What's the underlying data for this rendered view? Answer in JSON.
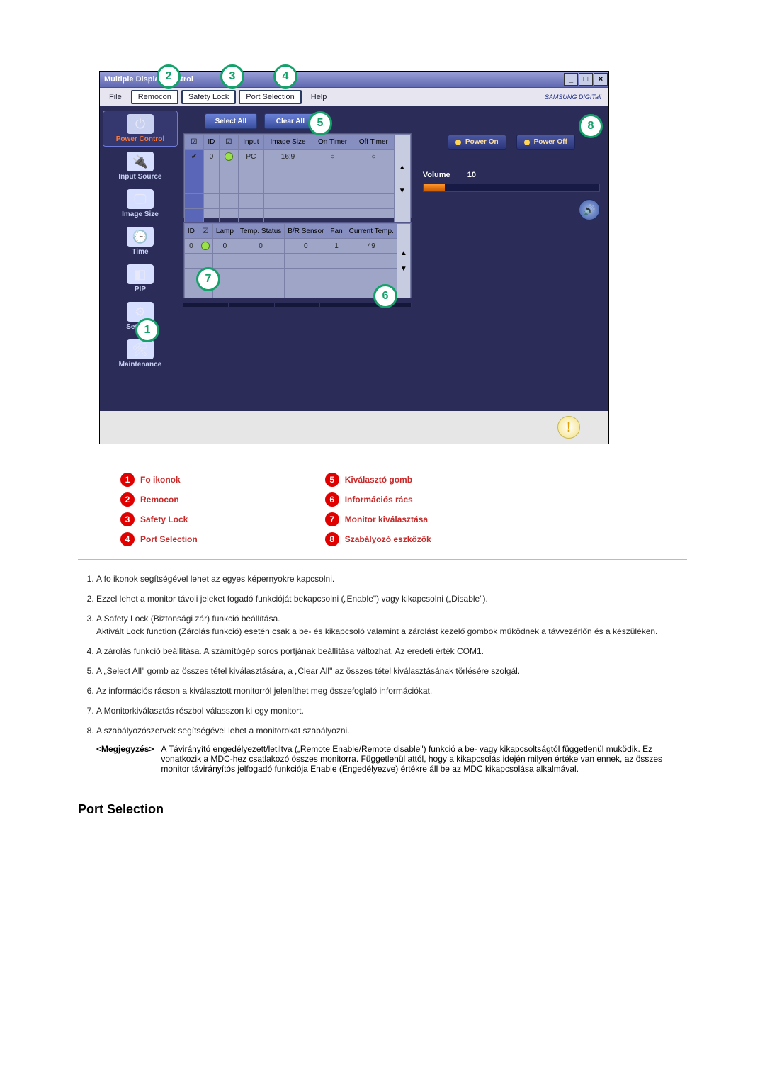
{
  "app": {
    "title": "Multiple Display Control",
    "brand": "SAMSUNG DIGITall"
  },
  "menu": {
    "file": "File",
    "remocon": "Remocon",
    "safety_lock": "Safety Lock",
    "port_selection": "Port Selection",
    "help": "Help"
  },
  "window_controls": {
    "min": "_",
    "max": "□",
    "close": "×"
  },
  "sidebar": {
    "power_control": "Power Control",
    "input_source": "Input Source",
    "image_size": "Image Size",
    "time": "Time",
    "pip": "PIP",
    "settings": "Settings",
    "maintenance": "Maintenance"
  },
  "buttons": {
    "select_all": "Select All",
    "clear_all": "Clear All"
  },
  "selection_grid": {
    "headers": [
      "",
      "ID",
      "",
      "Input",
      "Image Size",
      "On Timer",
      "Off Timer",
      ""
    ],
    "row": {
      "id": "0",
      "input": "PC",
      "image_size": "16:9",
      "on_timer": "○",
      "off_timer": "○"
    }
  },
  "info_grid": {
    "headers": [
      "ID",
      "",
      "Lamp",
      "Temp. Status",
      "B/R Sensor",
      "Fan",
      "Current Temp.",
      ""
    ],
    "row": {
      "id": "0",
      "lamp": "0",
      "temp_status": "0",
      "br_sensor": "0",
      "fan": "1",
      "current_temp": "49"
    }
  },
  "right": {
    "power_on": "Power On",
    "power_off": "Power Off",
    "volume_label": "Volume",
    "volume_value": "10"
  },
  "legend": {
    "l1": "Fo ikonok",
    "l2": "Remocon",
    "l3": "Safety Lock",
    "l4": "Port Selection",
    "l5": "Kiválasztó gomb",
    "l6": "Információs rács",
    "l7": "Monitor kiválasztása",
    "l8": "Szabályozó eszközök"
  },
  "desc": {
    "d1": "A fo ikonok segítségével lehet az egyes képernyokre kapcsolni.",
    "d2": "Ezzel lehet a monitor távoli jeleket fogadó funkcióját bekapcsolni („Enable\") vagy kikapcsolni („Disable\").",
    "d3a": "A Safety Lock (Biztonsági zár) funkció beállítása.",
    "d3b": "Aktivált Lock function (Zárolás funkció) esetén csak a be- és kikapcsoló valamint a zárolást kezelő gombok működnek a távvezérlőn és a készüléken.",
    "d4": "A zárolás funkció beállítása. A számítógép soros portjának beállítása változhat. Az eredeti érték COM1.",
    "d5": "A „Select All\" gomb az összes tétel kiválasztására, a „Clear All\" az összes tétel kiválasztásának törlésére szolgál.",
    "d6": "Az információs rácson a kiválasztott monitorról jeleníthet meg összefoglaló információkat.",
    "d7": "A Monitorkiválasztás részbol válasszon ki egy monitort.",
    "d8": "A szabályozószervek segítségével lehet a monitorokat szabályozni.",
    "note_label": "<Megjegyzés>",
    "note_text": "A Távirányító engedélyezett/letiltva („Remote Enable/Remote disable\") funkció a be- vagy kikapcsoltságtól függetlenül muködik. Ez vonatkozik a MDC-hez csatlakozó összes monitorra. Függetlenül attól, hogy a kikapcsolás idején milyen értéke van ennek, az összes monitor távirányítós jelfogadó funkciója Enable (Engedélyezve) értékre áll be az MDC kikapcsolása alkalmával."
  },
  "section_heading": "Port Selection"
}
